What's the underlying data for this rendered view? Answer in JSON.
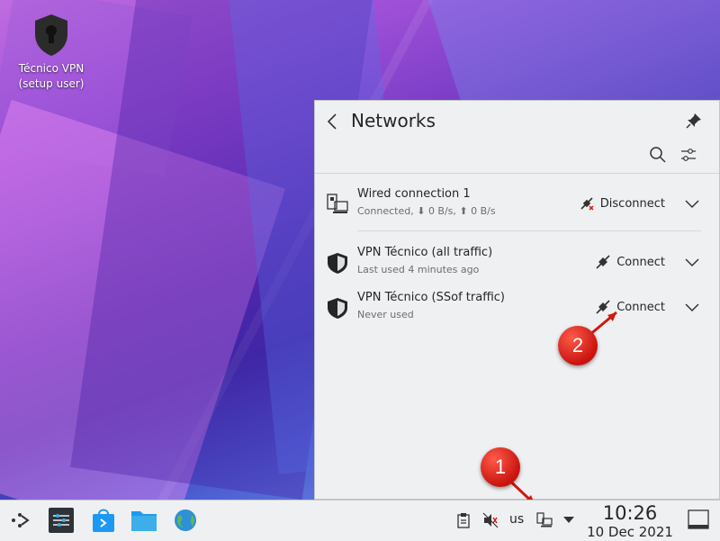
{
  "desktop": {
    "icon_label_line1": "Técnico VPN",
    "icon_label_line2": "(setup user)"
  },
  "popup": {
    "title": "Networks",
    "connections": [
      {
        "name": "Wired connection 1",
        "status": "Connected, ⬇ 0 B/s, ⬆ 0 B/s",
        "action": "Disconnect",
        "icon": "wired-network-icon"
      },
      {
        "name": "VPN Técnico (all traffic)",
        "status": "Last used 4 minutes ago",
        "action": "Connect",
        "icon": "vpn-shield-icon"
      },
      {
        "name": "VPN Técnico (SSof traffic)",
        "status": "Never used",
        "action": "Connect",
        "icon": "vpn-shield-icon"
      }
    ]
  },
  "annotations": {
    "badge1": "1",
    "badge2": "2",
    "color": "#d0180f"
  },
  "taskbar": {
    "keyboard_layout": "us",
    "time": "10:26",
    "date": "10 Dec 2021"
  },
  "colors": {
    "accent": "#3daee9",
    "panel": "#eff0f1"
  }
}
